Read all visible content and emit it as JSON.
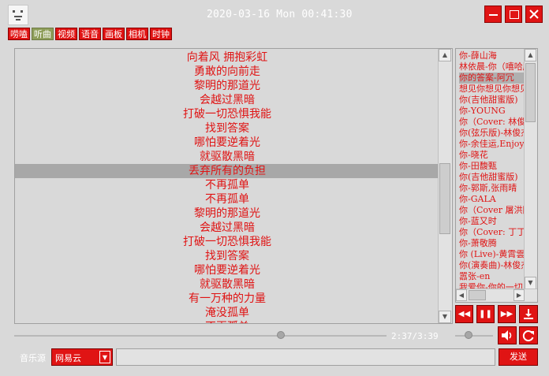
{
  "header": {
    "datetime": "2020-03-16 Mon 00:41:30",
    "icons": {
      "logo": "app-logo-icon",
      "minimize": "minimize-icon",
      "maximize": "maximize-icon",
      "close": "close-icon"
    }
  },
  "tabs": [
    {
      "label": "唠嗑",
      "active": false
    },
    {
      "label": "听曲",
      "active": true
    },
    {
      "label": "视频",
      "active": false
    },
    {
      "label": "语音",
      "active": false
    },
    {
      "label": "画板",
      "active": false
    },
    {
      "label": "相机",
      "active": false
    },
    {
      "label": "时钟",
      "active": false
    }
  ],
  "lyrics": [
    "向着风 拥抱彩虹",
    "勇敢的向前走",
    "黎明的那道光",
    "会越过黑暗",
    "打破一切恐惧我能",
    "找到答案",
    "哪怕要逆着光",
    "就驱散黑暗",
    "丢弃所有的负担",
    "不再孤单",
    "不再孤单",
    "黎明的那道光",
    "会越过黑暗",
    "打破一切恐惧我能",
    "找到答案",
    "哪怕要逆着光",
    "就驱散黑暗",
    "有一万种的力量",
    "淹没孤单",
    "不再孤单"
  ],
  "lyrics_highlight_index": 8,
  "playlist": {
    "selected_index": 2,
    "items": [
      "你-薛山海",
      "林依晨-你（嘻哈版）",
      "你的答案-阿冗",
      "想见你想见你想见你",
      "你(吉他甜蜜版)",
      "你-YOUNG",
      "你（Cover: 林俊杰）",
      "你(弦乐版)-林俊杰",
      "你-余佳运,Enjoy",
      "你-晓花",
      "你-田馥甄",
      "你(吉他甜蜜版)",
      "你-郭斯,张雨晴",
      "你-GALA",
      "你（Cover 屠洪刚）",
      "你-蓝又时",
      "你（Cover: 丁丁）",
      "你-萧敬腾",
      "你 (Live)-黄霄雲",
      "你(演奏曲)-林俊杰",
      "嚣张-en",
      "我爱你-你的一切"
    ]
  },
  "controls": {
    "prev": "prev-icon",
    "pause": "pause-icon",
    "next": "next-icon",
    "download": "download-icon",
    "volume": "volume-icon",
    "refresh": "refresh-icon"
  },
  "playback": {
    "time_text": "2:37/3:39",
    "progress": 0.717,
    "volume": 0.35
  },
  "bottom": {
    "source_label": "音乐源",
    "source_value": "网易云",
    "search_value": "",
    "send_label": "发送"
  },
  "colors": {
    "accent": "#e01414",
    "active_tab": "#8e9e5a",
    "background": "#d9d9d9",
    "highlight_row": "#a8a8a8"
  }
}
